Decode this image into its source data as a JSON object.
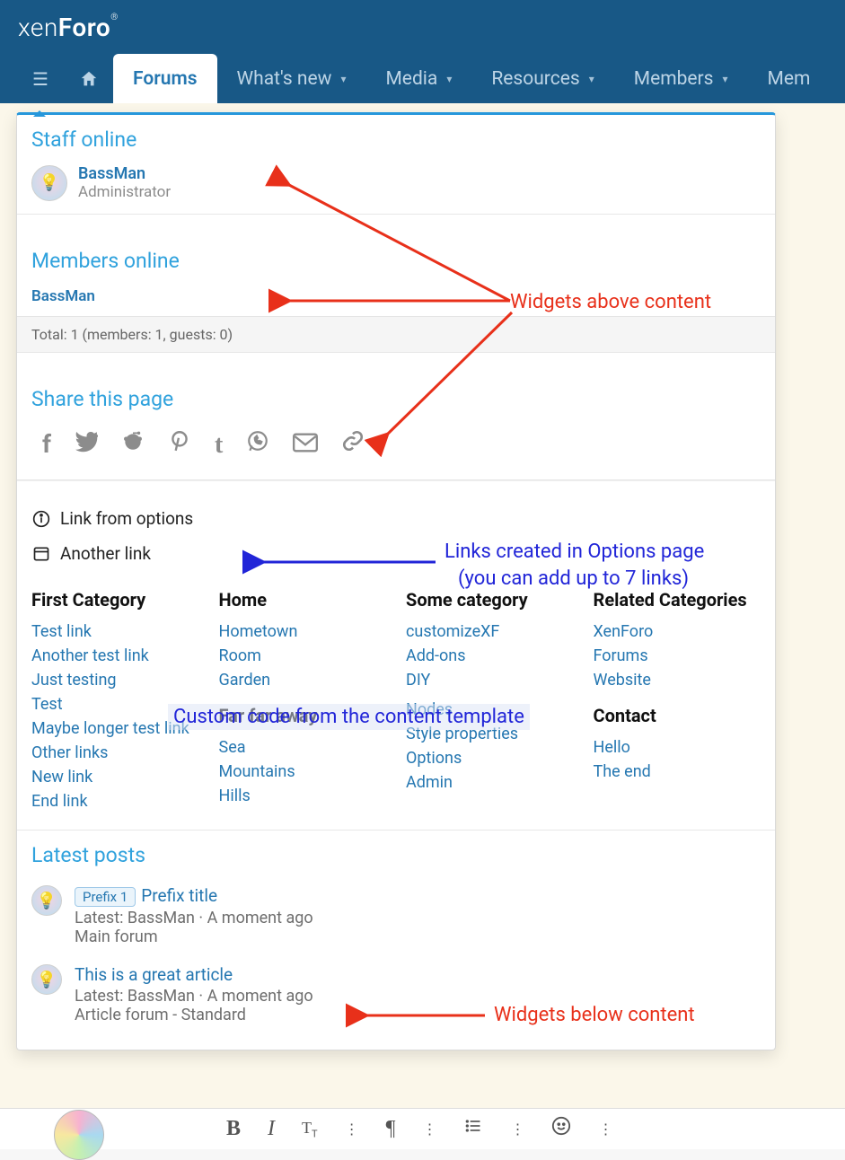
{
  "brand": {
    "name_pre": "xen",
    "name_post": "Foro",
    "reg": "®"
  },
  "nav": {
    "items": [
      {
        "label": "Forums",
        "active": true,
        "caret": false
      },
      {
        "label": "What's new",
        "active": false,
        "caret": true
      },
      {
        "label": "Media",
        "active": false,
        "caret": true
      },
      {
        "label": "Resources",
        "active": false,
        "caret": true
      },
      {
        "label": "Members",
        "active": false,
        "caret": true
      },
      {
        "label": "Mem",
        "active": false,
        "caret": false
      }
    ]
  },
  "widgets_above": {
    "staff_online": {
      "title": "Staff online",
      "user_name": "BassMan",
      "user_role": "Administrator"
    },
    "members_online": {
      "title": "Members online",
      "member": "BassMan",
      "totals": "Total: 1 (members: 1, guests: 0)"
    },
    "share": {
      "title": "Share this page"
    }
  },
  "option_links": [
    {
      "icon": "info",
      "label": "Link from options"
    },
    {
      "icon": "window",
      "label": "Another link"
    }
  ],
  "categories": [
    {
      "heading": "First Category",
      "links": [
        "Test link",
        "Another test link",
        "Just testing",
        "Test",
        "Maybe longer test link",
        "Other links",
        "New link",
        "End link"
      ]
    },
    {
      "heading": "Home",
      "links": [
        "Hometown",
        "Room",
        "Garden"
      ],
      "heading2": "Far far away",
      "links2": [
        "Sea",
        "Mountains",
        "Hills"
      ]
    },
    {
      "heading": "Some category",
      "links": [
        "customizeXF",
        "Add-ons",
        "DIY",
        "",
        "Nodes",
        "Style properties",
        "Options",
        "Admin"
      ]
    },
    {
      "heading": "Related Categories",
      "links": [
        "XenForo",
        "Forums",
        "Website"
      ],
      "heading2": "Contact",
      "links2": [
        "Hello",
        "The end"
      ]
    }
  ],
  "overlay_note": "Custom code from the content template",
  "latest_posts": {
    "title": "Latest posts",
    "items": [
      {
        "prefix": "Prefix 1",
        "title": "Prefix title",
        "meta": "Latest: BassMan · A moment ago",
        "forum": "Main forum"
      },
      {
        "prefix": "",
        "title": "This is a great article",
        "meta": "Latest: BassMan · A moment ago",
        "forum": "Article forum - Standard"
      }
    ]
  },
  "annotations": {
    "above": "Widgets above content",
    "options": "Links created in Options page",
    "options2": "(you can add up to 7 links)",
    "below": "Widgets below content"
  },
  "colors": {
    "brand_bg": "#185886",
    "accent": "#2697db",
    "link": "#2577b1",
    "red": "#e8301a",
    "blue": "#2125d8"
  }
}
